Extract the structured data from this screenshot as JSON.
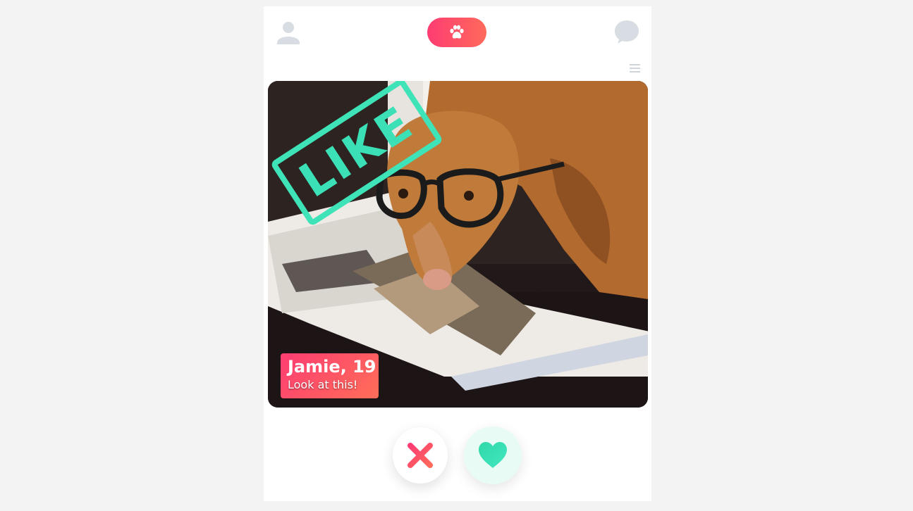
{
  "header": {
    "profile_icon": "person-icon",
    "center_icon": "paw-icon",
    "chat_icon": "chat-bubble-icon",
    "menu_icon": "hamburger-menu-icon"
  },
  "card": {
    "photo": "dog-with-glasses-on-magazine",
    "stamp_text": "LIKE",
    "name": "Jamie, 19",
    "caption": "Look at this!"
  },
  "actions": {
    "nope_icon": "cross-icon",
    "like_icon": "heart-icon"
  },
  "colors": {
    "accent_pink": "#fe3c72",
    "accent_orange": "#ff6a5b",
    "like_green": "#3fe3b8",
    "background": "#f3f3f3",
    "icon_gray": "#d8dde3"
  }
}
